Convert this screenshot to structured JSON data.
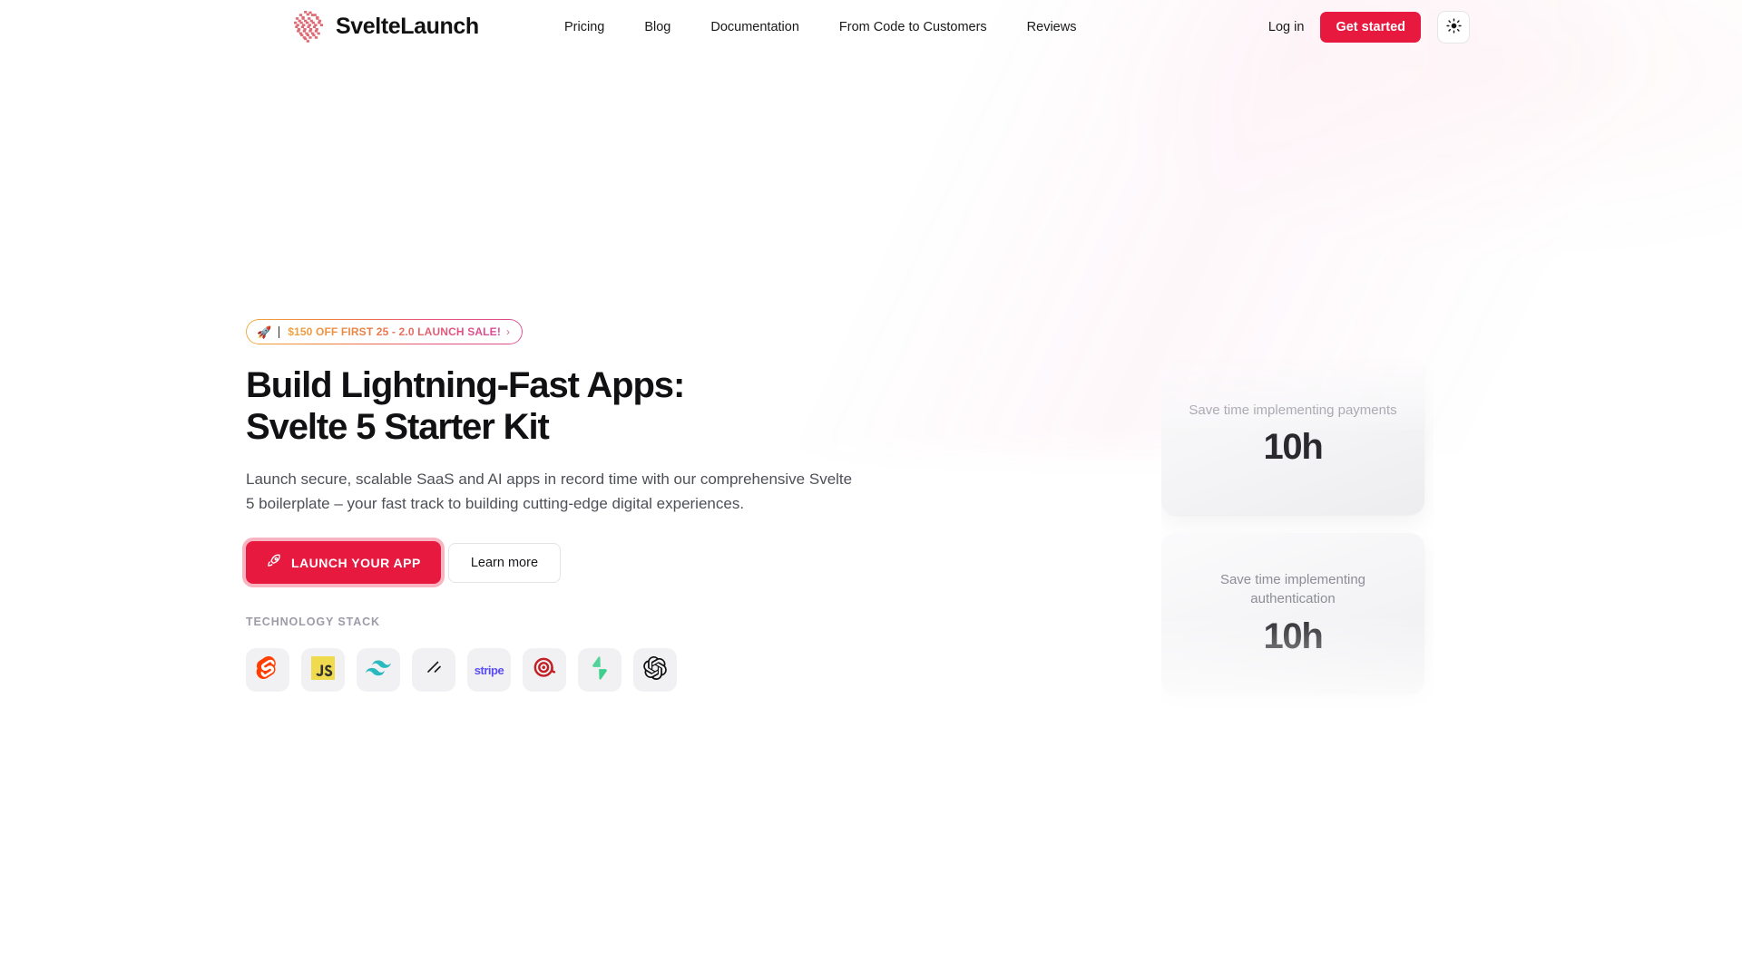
{
  "brand": {
    "name": "SvelteLaunch",
    "logo_icon": "sveltelaunch-logo-icon",
    "logo_color": "#dd6b75"
  },
  "nav": {
    "items": [
      {
        "label": "Pricing"
      },
      {
        "label": "Blog"
      },
      {
        "label": "Documentation"
      },
      {
        "label": "From Code to Customers"
      },
      {
        "label": "Reviews"
      }
    ],
    "login_label": "Log in",
    "get_started_label": "Get started",
    "theme_toggle_icon": "sun-icon"
  },
  "hero": {
    "announcement": {
      "rocket_icon": "rocket-emoji-icon",
      "text": "$150 OFF FIRST 25 - 2.0 LAUNCH SALE!",
      "chevron": "›"
    },
    "title": "Build Lightning-Fast Apps: Svelte 5 Starter Kit",
    "subtitle": "Launch secure, scalable SaaS and AI apps in record time with our comprehensive Svelte 5 boilerplate – your fast track to building cutting-edge digital experiences.",
    "primary_cta": {
      "label": "LAUNCH YOUR APP",
      "icon": "rocket-icon"
    },
    "secondary_cta": {
      "label": "Learn more"
    },
    "stack_label": "TECHNOLOGY STACK",
    "stack_items": [
      {
        "name": "svelte-icon",
        "title": "Svelte"
      },
      {
        "name": "javascript-icon",
        "title": "JavaScript"
      },
      {
        "name": "tailwindcss-icon",
        "title": "Tailwind CSS"
      },
      {
        "name": "shadcn-icon",
        "title": "shadcn"
      },
      {
        "name": "stripe-icon",
        "title": "Stripe"
      },
      {
        "name": "mailgun-icon",
        "title": "Mailgun"
      },
      {
        "name": "supabase-icon",
        "title": "Supabase"
      },
      {
        "name": "openai-icon",
        "title": "OpenAI"
      }
    ]
  },
  "stat_cards": [
    {
      "caption": "Save time implementing payments",
      "value": "10h"
    },
    {
      "caption": "Save time implementing authentication",
      "value": "10h"
    }
  ],
  "colors": {
    "brand_red": "#e8193f",
    "text_primary": "#111113",
    "text_muted": "#4e5057",
    "chip_bg": "#f1f1f3"
  }
}
